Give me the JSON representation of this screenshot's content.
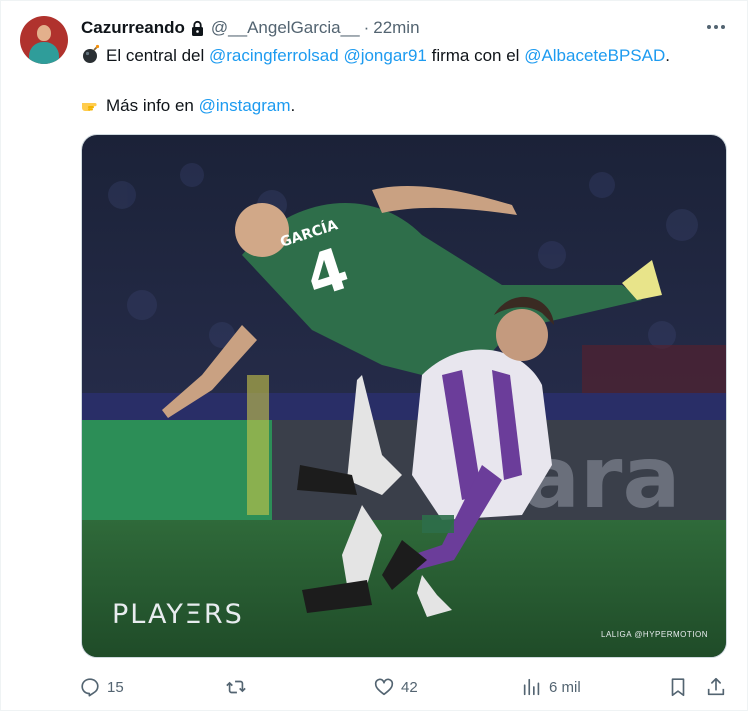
{
  "tweet": {
    "author": {
      "display_name": "Cazurreando",
      "handle": "@__AngelGarcia__",
      "separator": "·",
      "time": "22min"
    },
    "text": {
      "line1_prefix": "El central del ",
      "mention_1": "@racingferrolsad",
      "mention_2": "@jongar91",
      "line1_middle": " firma con el ",
      "mention_3": "@AlbaceteBPSAD",
      "line1_suffix": ".",
      "line2_prefix": "Más info en ",
      "mention_4": "@instagram",
      "line2_suffix": "."
    },
    "media": {
      "brand_overlay": "PLAYΞRS",
      "credit_overlay": "LALIGA @HYPERMOTION",
      "jersey_name": "GARCÍA",
      "jersey_number": "4"
    },
    "actions": {
      "replies": "15",
      "likes": "42",
      "views": "6 mil"
    },
    "icons": {
      "lock": "lock-icon",
      "bomb_emoji": "bomb-emoji",
      "pointing_emoji": "backhand-index-pointing-right-emoji",
      "reply": "reply-icon",
      "retweet": "retweet-icon",
      "like": "heart-icon",
      "views": "bar-chart-icon",
      "bookmark": "bookmark-icon",
      "share": "share-icon",
      "more": "more-icon"
    },
    "colors": {
      "link": "#1d9bf0",
      "secondary_text": "#536471",
      "primary_text": "#0f1419"
    }
  }
}
